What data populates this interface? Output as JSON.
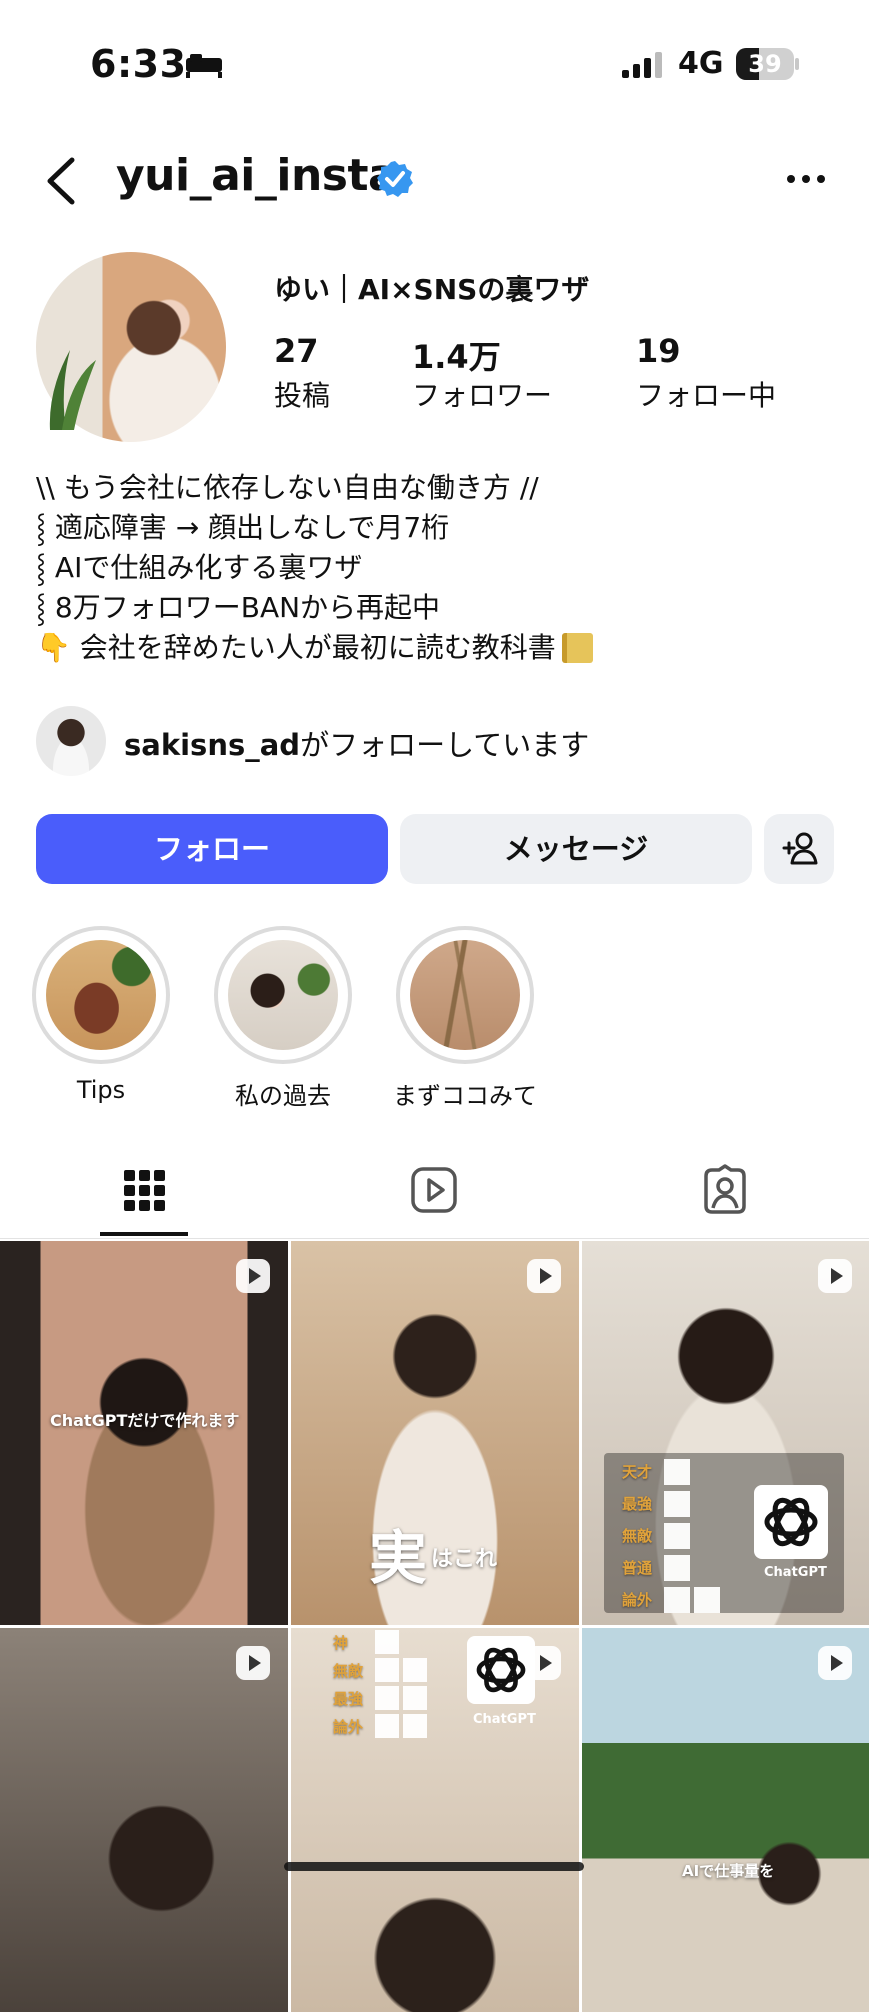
{
  "status_bar": {
    "time": "6:33",
    "network": "4G",
    "battery": "39",
    "battery_level": 0.39
  },
  "header": {
    "username": "yui_ai_insta"
  },
  "profile": {
    "display_name": "ゆい｜AI×SNSの裏ワザ",
    "stats": [
      {
        "value": "27",
        "label": "投稿"
      },
      {
        "value": "1.4万",
        "label": "フォロワー"
      },
      {
        "value": "19",
        "label": "フォロー中"
      }
    ],
    "bio": [
      "\\\\ もう会社に依存しない自由な働き方 //",
      "⸾ 適応障害 → 顔出しなしで月7桁",
      "⸾ AIで仕組み化する裏ワザ",
      "⸾ 8万フォロワーBANから再起中",
      "👇 会社を辞めたい人が最初に読む教科書"
    ],
    "followed_by_user": "sakisns_ad",
    "followed_by_suffix": "がフォローしています"
  },
  "actions": {
    "follow": "フォロー",
    "message": "メッセージ"
  },
  "highlights": [
    {
      "label": "Tips"
    },
    {
      "label": "私の過去"
    },
    {
      "label": "まずココみて"
    }
  ],
  "grid": {
    "captions": {
      "cell0": "ChatGPTだけで作れます",
      "cell1_big": "実",
      "cell1_small": "はこれ",
      "cell5": "AIで仕事量を"
    },
    "rank_labels_a": [
      "天才",
      "最強",
      "無敵",
      "普通",
      "論外"
    ],
    "rank_labels_b": [
      "神",
      "無敵",
      "最強",
      "論外"
    ],
    "chatgpt": "ChatGPT"
  }
}
